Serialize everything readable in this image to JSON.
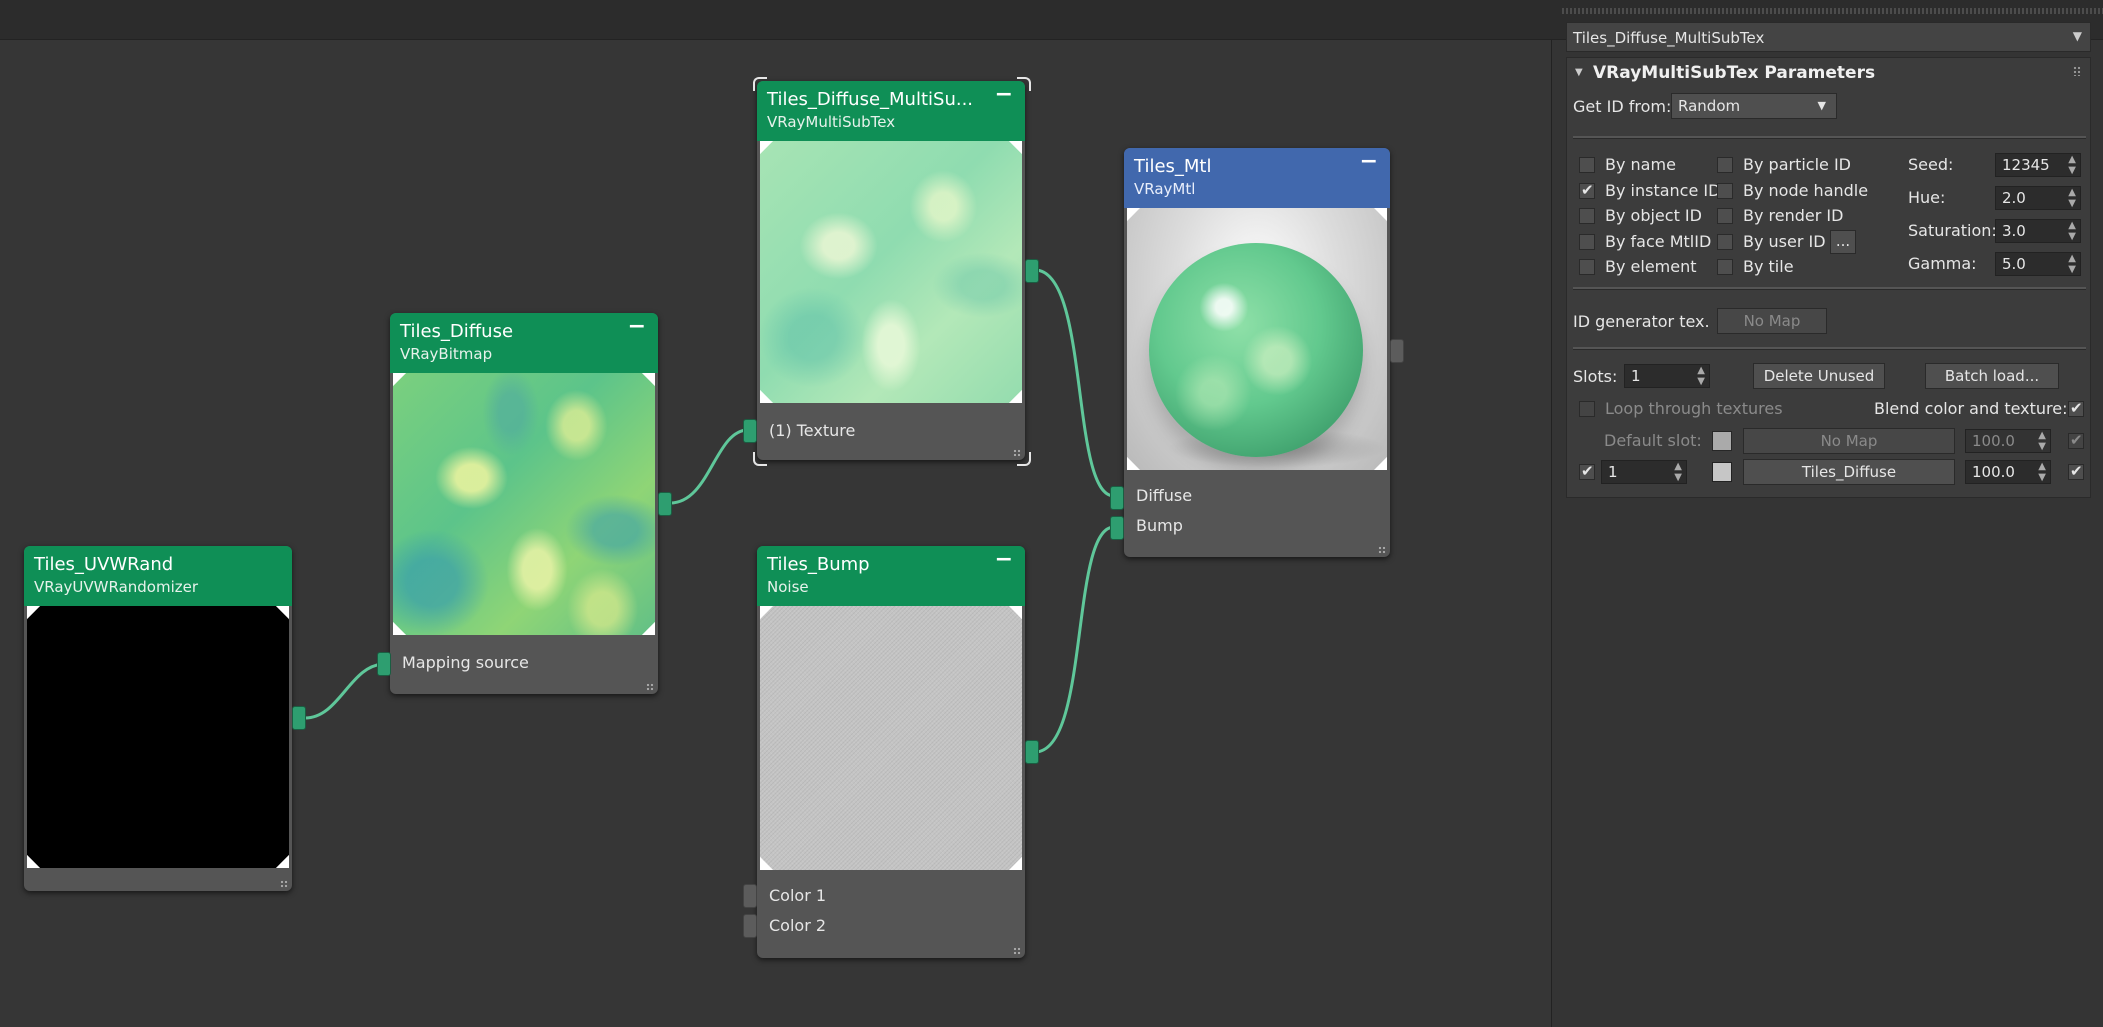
{
  "nodes": {
    "uvwrand": {
      "title": "Tiles_UVWRand",
      "type": "VRayUVWRandomizer"
    },
    "diffuse": {
      "title": "Tiles_Diffuse",
      "type": "VRayBitmap",
      "port_in": "Mapping source"
    },
    "multisub": {
      "title": "Tiles_Diffuse_MultiSu...",
      "type": "VRayMultiSubTex",
      "port_in": "(1) Texture"
    },
    "bump": {
      "title": "Tiles_Bump",
      "type": "Noise",
      "port_color1": "Color 1",
      "port_color2": "Color 2"
    },
    "mtl": {
      "title": "Tiles_Mtl",
      "type": "VRayMtl",
      "port_diffuse": "Diffuse",
      "port_bump": "Bump"
    },
    "minimize_glyph": "−"
  },
  "panel": {
    "dropdown_title": "Tiles_Diffuse_MultiSubTex",
    "rollout_title": "VRayMultiSubTex Parameters",
    "get_id_label": "Get ID from:",
    "get_id_value": "Random",
    "id_sources_col1": [
      {
        "label": "By name",
        "checked": false
      },
      {
        "label": "By instance ID",
        "checked": true
      },
      {
        "label": "By object ID",
        "checked": false
      },
      {
        "label": "By face MtlID",
        "checked": false
      },
      {
        "label": "By element",
        "checked": false
      }
    ],
    "id_sources_col2": [
      {
        "label": "By particle ID",
        "checked": false
      },
      {
        "label": "By node handle",
        "checked": false
      },
      {
        "label": "By render ID",
        "checked": false
      },
      {
        "label": "By user ID",
        "checked": false
      },
      {
        "label": "By tile",
        "checked": false
      }
    ],
    "user_id_button": "...",
    "seed_label": "Seed:",
    "seed_value": "12345",
    "hue_label": "Hue:",
    "hue_value": "2.0",
    "saturation_label": "Saturation:",
    "saturation_value": "3.0",
    "gamma_label": "Gamma:",
    "gamma_value": "5.0",
    "id_gen_label": "ID generator tex.",
    "id_gen_button": "No Map",
    "slots_label": "Slots:",
    "slots_value": "1",
    "delete_unused": "Delete Unused",
    "batch_load": "Batch load...",
    "loop_label": "Loop through textures",
    "loop_checked": false,
    "blend_label": "Blend color and texture:",
    "blend_checked": true,
    "default_slot_label": "Default slot:",
    "default_slot_map": "No Map",
    "default_slot_amount": "100.0",
    "default_slot_checked": true,
    "slot1_checked": true,
    "slot1_id": "1",
    "slot1_map": "Tiles_Diffuse",
    "slot1_amount": "100.0",
    "slot1_enabled": true
  },
  "colors": {
    "node_green": "#0f8f56",
    "node_blue": "#4168ad",
    "wire": "#5fc79a"
  }
}
